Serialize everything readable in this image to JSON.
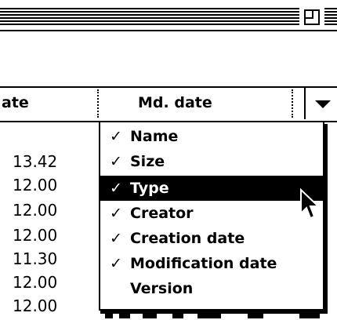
{
  "window": {
    "zoom_box_icon": "zoom-box-icon"
  },
  "header": {
    "col_date_label": "ate",
    "col_md_label": "Md. date",
    "popup_icon": "triangle-down-icon"
  },
  "rows": {
    "times": [
      "13.42",
      "12.00",
      "12.00",
      "12.00",
      "11.30",
      "12.00",
      "12.00"
    ]
  },
  "menu": {
    "items": [
      {
        "check": "✓",
        "label": "Name",
        "highlighted": false
      },
      {
        "check": "✓",
        "label": "Size",
        "highlighted": false
      },
      {
        "check": "✓",
        "label": "Type",
        "highlighted": true
      },
      {
        "check": "✓",
        "label": "Creator",
        "highlighted": false
      },
      {
        "check": "✓",
        "label": "Creation date",
        "highlighted": false
      },
      {
        "check": "✓",
        "label": "Modification date",
        "highlighted": false
      },
      {
        "check": "",
        "label": "Version",
        "highlighted": false
      }
    ]
  },
  "cursor": {
    "icon": "arrow-cursor-icon"
  }
}
